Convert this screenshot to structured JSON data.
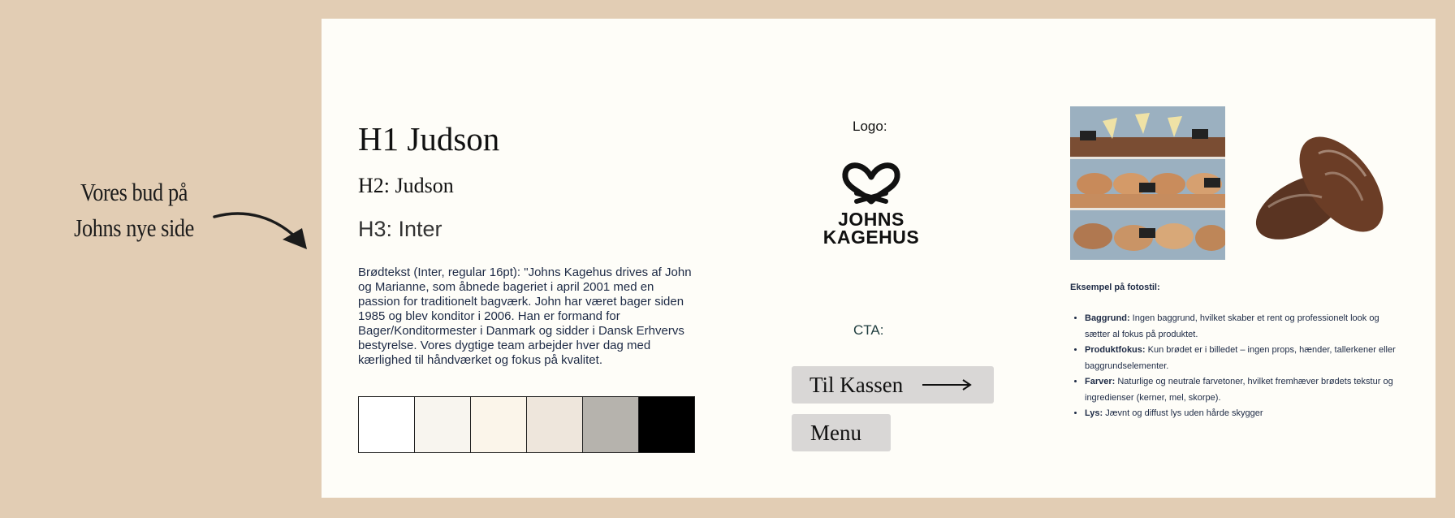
{
  "side_note": {
    "line1": "Vores bud på",
    "line2": "Johns nye side"
  },
  "typography": {
    "h1": "H1 Judson",
    "h2": "H2: Judson",
    "h3": "H3: Inter",
    "body": "Brødtekst (Inter, regular 16pt): \"Johns Kagehus drives af John og Marianne, som åbnede bageriet i april 2001 med en passion for traditionelt bagværk. John har været bager siden 1985 og blev konditor i 2006. Han er formand for Bager/Konditormester i Danmark og sidder i Dansk Erhvervs bestyrelse. Vores dygtige team arbejder hver dag med kærlighed til håndværket og fokus på kvalitet."
  },
  "palette": [
    "#ffffff",
    "#f8f5ef",
    "#fbf5ea",
    "#eee6dc",
    "#b6b3ad",
    "#000000"
  ],
  "logo": {
    "label": "Logo:",
    "line1": "JOHNS",
    "line2": "KAGEHUS",
    "icon": "pretzel-icon"
  },
  "cta": {
    "label": "CTA:",
    "primary": "Til Kassen",
    "secondary": "Menu"
  },
  "photo_style": {
    "title": "Eksempel på fotostil:",
    "items": [
      {
        "term": "Baggrund:",
        "text": "  Ingen baggrund, hvilket skaber et rent og professionelt look og sætter al fokus på produktet."
      },
      {
        "term": "Produktfokus:",
        "text": " Kun brødet er i billedet – ingen props, hænder, tallerkener eller baggrundselementer."
      },
      {
        "term": "Farver:",
        "text": " Naturlige og neutrale farvetoner, hvilket fremhæver brødets tekstur og ingredienser (kerner, mel, skorpe)."
      },
      {
        "term": "Lys:",
        "text": " Jævnt og diffust lys uden hårde skygger"
      }
    ]
  },
  "colors": {
    "page_bg": "#e2cdb4",
    "board_bg": "#fefdf8",
    "button_bg": "#d9d7d6",
    "text_navy": "#1d2a45"
  }
}
